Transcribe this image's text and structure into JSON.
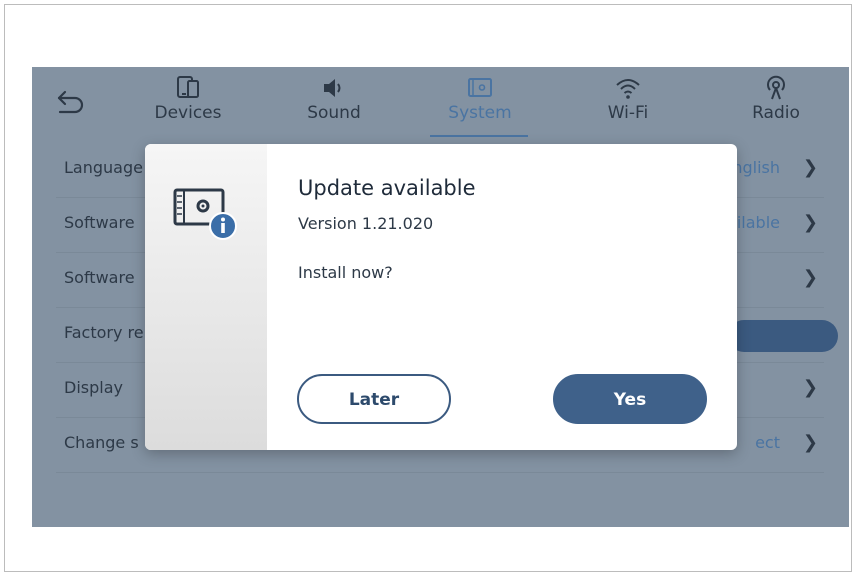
{
  "nav": {
    "tabs": [
      {
        "label": "Devices",
        "icon": "phone-icon"
      },
      {
        "label": "Sound",
        "icon": "speaker-icon"
      },
      {
        "label": "System",
        "icon": "system-icon",
        "active": true
      },
      {
        "label": "Wi-Fi",
        "icon": "wifi-icon"
      },
      {
        "label": "Radio",
        "icon": "radio-icon"
      }
    ]
  },
  "settings": {
    "rows": [
      {
        "label": "Language",
        "value": "English"
      },
      {
        "label": "Software",
        "value": "available"
      },
      {
        "label": "Software",
        "value": ""
      },
      {
        "label": "Factory re",
        "value": ""
      },
      {
        "label": "Display",
        "value": ""
      },
      {
        "label": "Change s",
        "value": "ect"
      }
    ]
  },
  "dialog": {
    "title": "Update available",
    "version": "Version 1.21.020",
    "question": "Install now?",
    "later_label": "Later",
    "yes_label": "Yes"
  },
  "colors": {
    "accent": "#4a74a2",
    "primary_button": "#3f618a",
    "overlay": "#8392a2"
  }
}
